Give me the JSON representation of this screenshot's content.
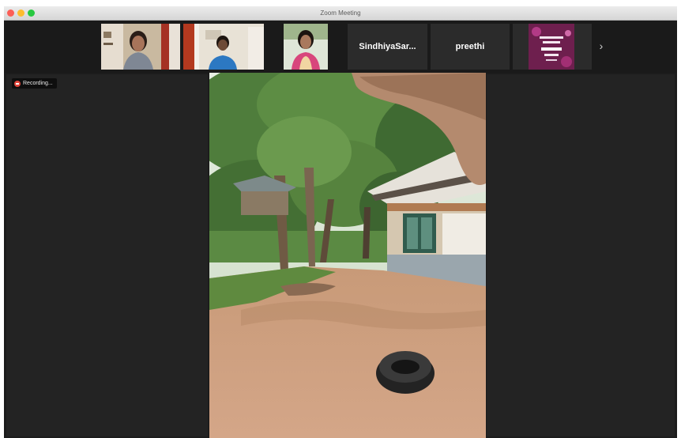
{
  "window": {
    "title": "Zoom Meeting"
  },
  "participants": [
    {
      "type": "video",
      "description": "woman-at-home"
    },
    {
      "type": "video",
      "description": "man-in-blue"
    },
    {
      "type": "video",
      "description": "woman-in-pink"
    },
    {
      "type": "name",
      "name": "SindhiyaSar..."
    },
    {
      "type": "name",
      "name": "preethi"
    },
    {
      "type": "video",
      "description": "poster-graphic"
    }
  ],
  "strip": {
    "next_icon": "chevron-right-icon",
    "next_glyph": "›"
  },
  "recording": {
    "label": "Recording..."
  },
  "colors": {
    "recording": "#e0443a",
    "background": "#1a1a1a",
    "tile": "#2b2b2b"
  }
}
